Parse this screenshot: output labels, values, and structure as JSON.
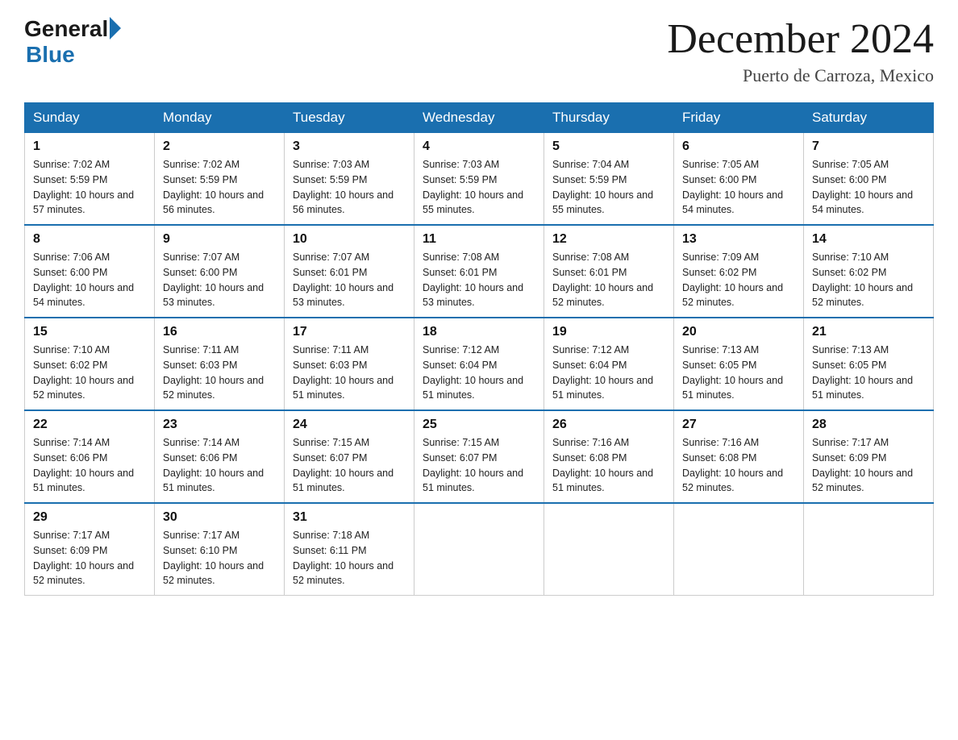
{
  "logo": {
    "general": "General",
    "blue": "Blue"
  },
  "title": "December 2024",
  "location": "Puerto de Carroza, Mexico",
  "days_of_week": [
    "Sunday",
    "Monday",
    "Tuesday",
    "Wednesday",
    "Thursday",
    "Friday",
    "Saturday"
  ],
  "weeks": [
    [
      {
        "day": "1",
        "sunrise": "7:02 AM",
        "sunset": "5:59 PM",
        "daylight": "10 hours and 57 minutes."
      },
      {
        "day": "2",
        "sunrise": "7:02 AM",
        "sunset": "5:59 PM",
        "daylight": "10 hours and 56 minutes."
      },
      {
        "day": "3",
        "sunrise": "7:03 AM",
        "sunset": "5:59 PM",
        "daylight": "10 hours and 56 minutes."
      },
      {
        "day": "4",
        "sunrise": "7:03 AM",
        "sunset": "5:59 PM",
        "daylight": "10 hours and 55 minutes."
      },
      {
        "day": "5",
        "sunrise": "7:04 AM",
        "sunset": "5:59 PM",
        "daylight": "10 hours and 55 minutes."
      },
      {
        "day": "6",
        "sunrise": "7:05 AM",
        "sunset": "6:00 PM",
        "daylight": "10 hours and 54 minutes."
      },
      {
        "day": "7",
        "sunrise": "7:05 AM",
        "sunset": "6:00 PM",
        "daylight": "10 hours and 54 minutes."
      }
    ],
    [
      {
        "day": "8",
        "sunrise": "7:06 AM",
        "sunset": "6:00 PM",
        "daylight": "10 hours and 54 minutes."
      },
      {
        "day": "9",
        "sunrise": "7:07 AM",
        "sunset": "6:00 PM",
        "daylight": "10 hours and 53 minutes."
      },
      {
        "day": "10",
        "sunrise": "7:07 AM",
        "sunset": "6:01 PM",
        "daylight": "10 hours and 53 minutes."
      },
      {
        "day": "11",
        "sunrise": "7:08 AM",
        "sunset": "6:01 PM",
        "daylight": "10 hours and 53 minutes."
      },
      {
        "day": "12",
        "sunrise": "7:08 AM",
        "sunset": "6:01 PM",
        "daylight": "10 hours and 52 minutes."
      },
      {
        "day": "13",
        "sunrise": "7:09 AM",
        "sunset": "6:02 PM",
        "daylight": "10 hours and 52 minutes."
      },
      {
        "day": "14",
        "sunrise": "7:10 AM",
        "sunset": "6:02 PM",
        "daylight": "10 hours and 52 minutes."
      }
    ],
    [
      {
        "day": "15",
        "sunrise": "7:10 AM",
        "sunset": "6:02 PM",
        "daylight": "10 hours and 52 minutes."
      },
      {
        "day": "16",
        "sunrise": "7:11 AM",
        "sunset": "6:03 PM",
        "daylight": "10 hours and 52 minutes."
      },
      {
        "day": "17",
        "sunrise": "7:11 AM",
        "sunset": "6:03 PM",
        "daylight": "10 hours and 51 minutes."
      },
      {
        "day": "18",
        "sunrise": "7:12 AM",
        "sunset": "6:04 PM",
        "daylight": "10 hours and 51 minutes."
      },
      {
        "day": "19",
        "sunrise": "7:12 AM",
        "sunset": "6:04 PM",
        "daylight": "10 hours and 51 minutes."
      },
      {
        "day": "20",
        "sunrise": "7:13 AM",
        "sunset": "6:05 PM",
        "daylight": "10 hours and 51 minutes."
      },
      {
        "day": "21",
        "sunrise": "7:13 AM",
        "sunset": "6:05 PM",
        "daylight": "10 hours and 51 minutes."
      }
    ],
    [
      {
        "day": "22",
        "sunrise": "7:14 AM",
        "sunset": "6:06 PM",
        "daylight": "10 hours and 51 minutes."
      },
      {
        "day": "23",
        "sunrise": "7:14 AM",
        "sunset": "6:06 PM",
        "daylight": "10 hours and 51 minutes."
      },
      {
        "day": "24",
        "sunrise": "7:15 AM",
        "sunset": "6:07 PM",
        "daylight": "10 hours and 51 minutes."
      },
      {
        "day": "25",
        "sunrise": "7:15 AM",
        "sunset": "6:07 PM",
        "daylight": "10 hours and 51 minutes."
      },
      {
        "day": "26",
        "sunrise": "7:16 AM",
        "sunset": "6:08 PM",
        "daylight": "10 hours and 51 minutes."
      },
      {
        "day": "27",
        "sunrise": "7:16 AM",
        "sunset": "6:08 PM",
        "daylight": "10 hours and 52 minutes."
      },
      {
        "day": "28",
        "sunrise": "7:17 AM",
        "sunset": "6:09 PM",
        "daylight": "10 hours and 52 minutes."
      }
    ],
    [
      {
        "day": "29",
        "sunrise": "7:17 AM",
        "sunset": "6:09 PM",
        "daylight": "10 hours and 52 minutes."
      },
      {
        "day": "30",
        "sunrise": "7:17 AM",
        "sunset": "6:10 PM",
        "daylight": "10 hours and 52 minutes."
      },
      {
        "day": "31",
        "sunrise": "7:18 AM",
        "sunset": "6:11 PM",
        "daylight": "10 hours and 52 minutes."
      },
      null,
      null,
      null,
      null
    ]
  ]
}
